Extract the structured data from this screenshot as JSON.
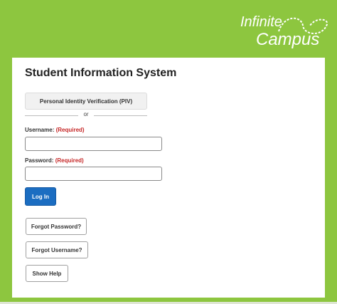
{
  "brand": {
    "line1": "Infinite",
    "line2": "Campus",
    "bg_color": "#8dc63f"
  },
  "login_form": {
    "title": "Student Information System",
    "piv_button_label": "Personal Identity Verification (PIV)",
    "separator_text": "or",
    "username_label": "Username:",
    "username_required": "(Required)",
    "username_value": "",
    "password_label": "Password:",
    "password_required": "(Required)",
    "password_value": "",
    "login_button_label": "Log In",
    "login_button_color": "#1b6dc1",
    "required_color": "#c62828"
  },
  "help_links": {
    "forgot_password_label": "Forgot Password?",
    "forgot_username_label": "Forgot Username?",
    "show_help_label": "Show Help"
  }
}
